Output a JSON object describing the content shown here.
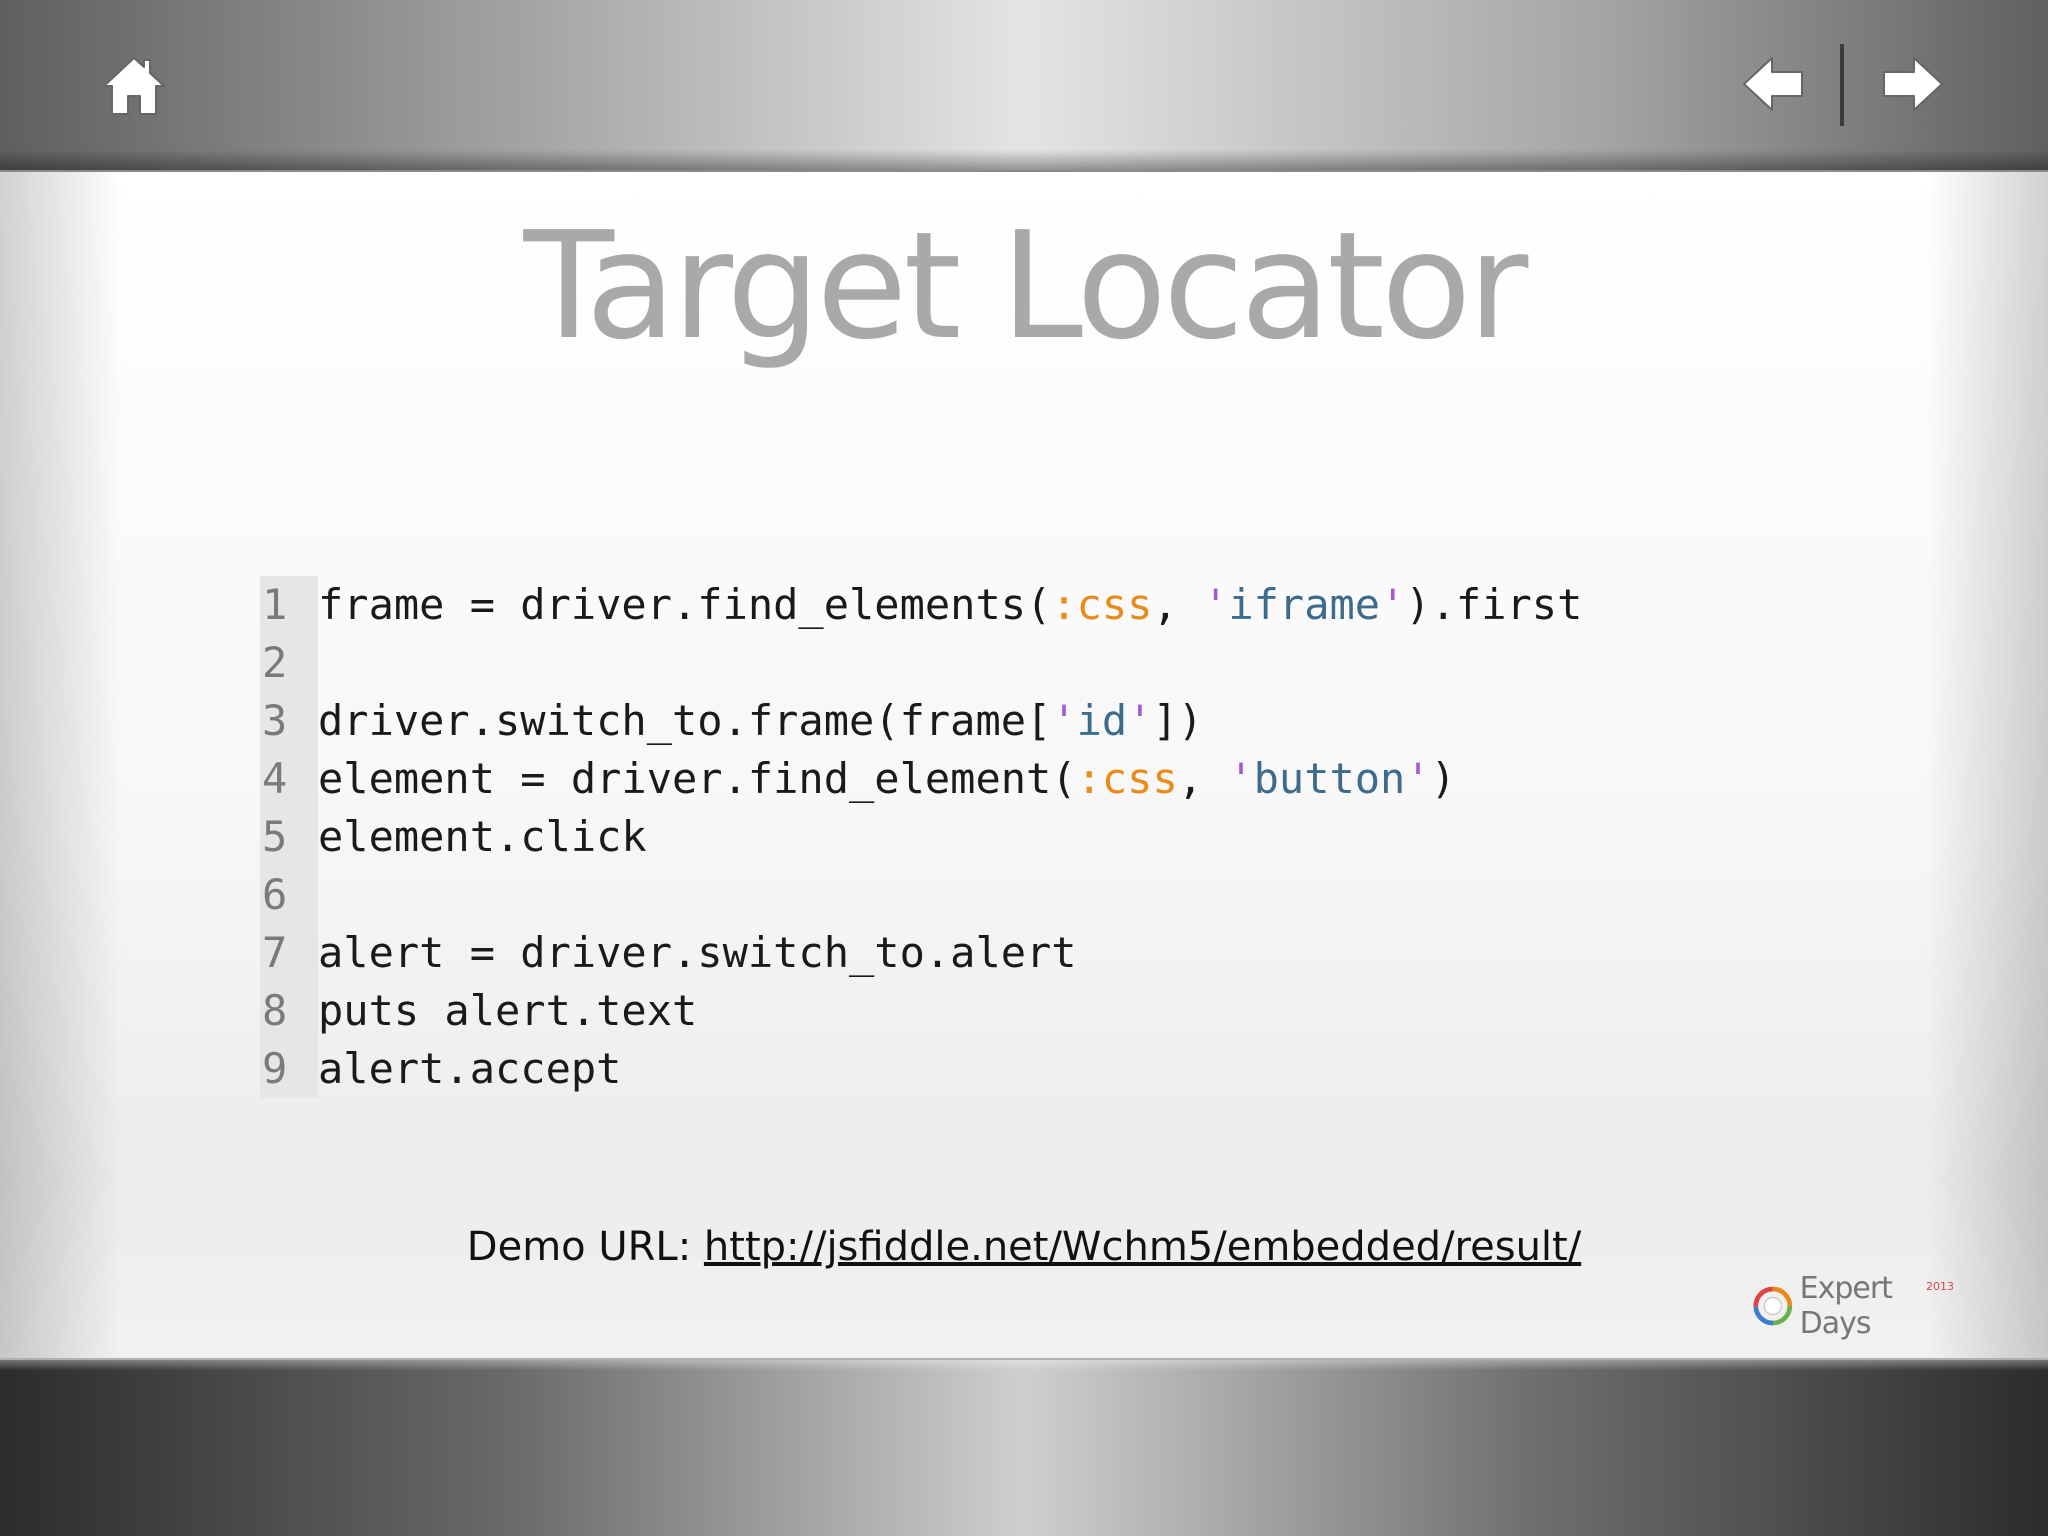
{
  "slide": {
    "title": "Target Locator"
  },
  "navigation": {
    "home_icon": "home-icon",
    "prev_icon": "arrow-left-icon",
    "next_icon": "arrow-right-icon"
  },
  "code": {
    "lines": [
      {
        "number": "1",
        "text": "frame = driver.find_elements(:css, 'iframe').first"
      },
      {
        "number": "2",
        "text": ""
      },
      {
        "number": "3",
        "text": "driver.switch_to.frame(frame['id'])"
      },
      {
        "number": "4",
        "text": "element = driver.find_element(:css, 'button')"
      },
      {
        "number": "5",
        "text": "element.click"
      },
      {
        "number": "6",
        "text": ""
      },
      {
        "number": "7",
        "text": "alert = driver.switch_to.alert"
      },
      {
        "number": "8",
        "text": "puts alert.text"
      },
      {
        "number": "9",
        "text": "alert.accept"
      }
    ],
    "colors": {
      "symbol": "#e98a1a",
      "string": "#3d6b8d",
      "quote": "#a25ad1",
      "gutter": "#e6e6e6"
    }
  },
  "demo": {
    "label": "Demo URL:",
    "url": "http://jsfiddle.net/Wchm5/embedded/result/"
  },
  "logo": {
    "text": "Expert Days",
    "year": "2013"
  }
}
